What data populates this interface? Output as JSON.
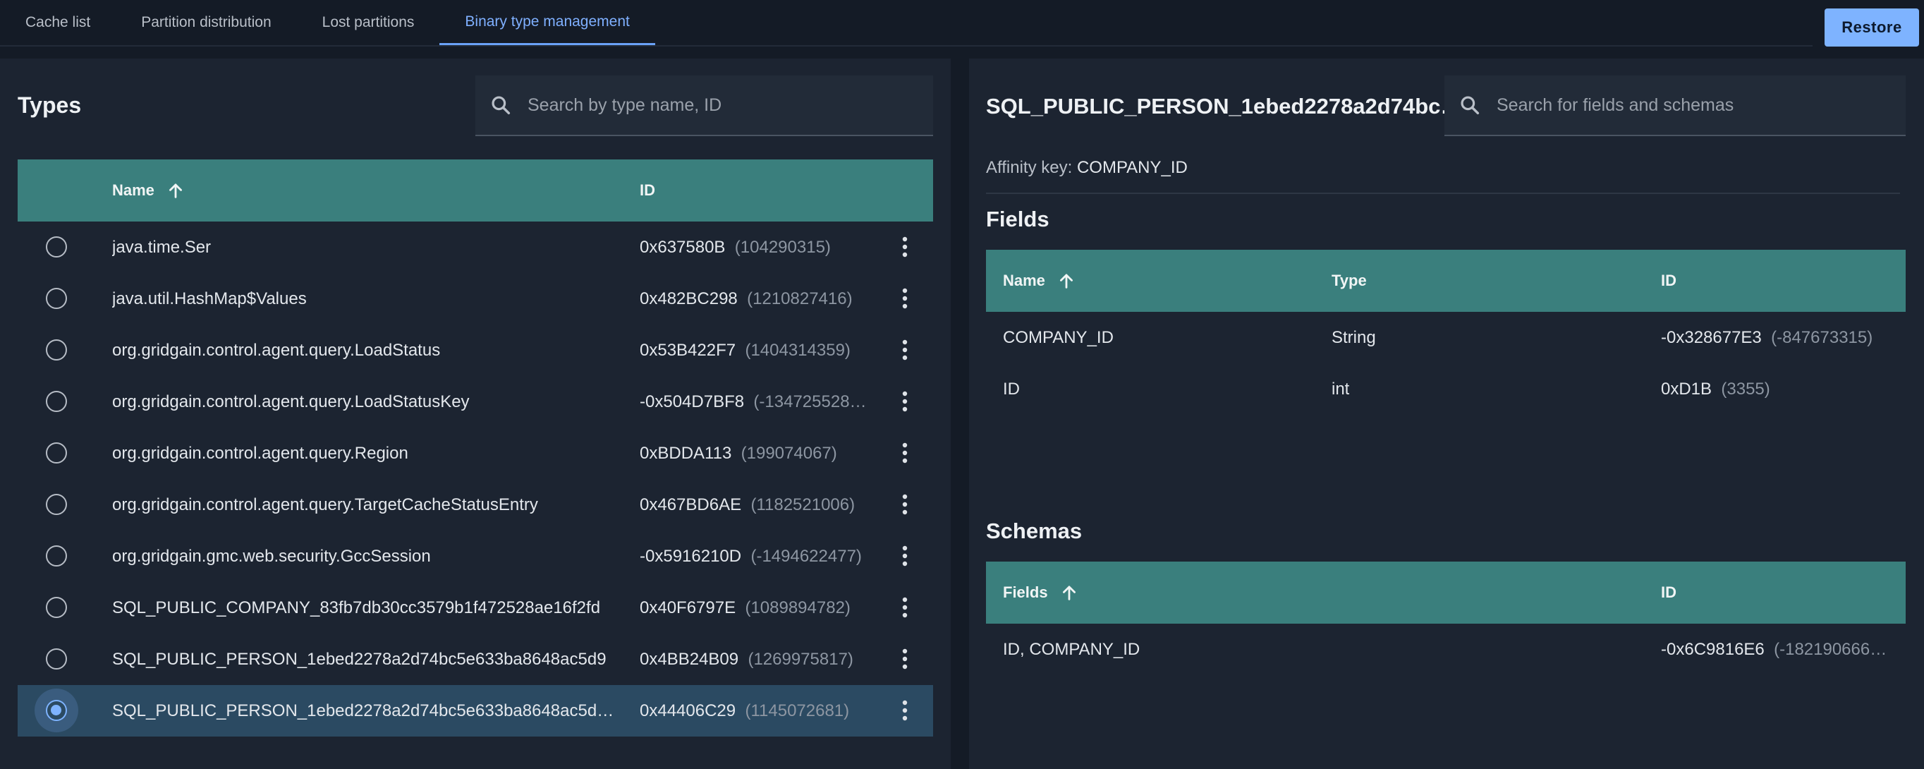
{
  "tabs": [
    {
      "label": "Cache list",
      "active": false
    },
    {
      "label": "Partition distribution",
      "active": false
    },
    {
      "label": "Lost partitions",
      "active": false
    },
    {
      "label": "Binary type management",
      "active": true
    }
  ],
  "restore_label": "Restore",
  "types_panel": {
    "title": "Types",
    "search_placeholder": "Search by type name, ID",
    "columns": {
      "name": "Name",
      "id": "ID"
    },
    "rows": [
      {
        "name": "java.time.Ser",
        "id": "0x637580B",
        "id_dec": "(104290315)",
        "selected": false
      },
      {
        "name": "java.util.HashMap$Values",
        "id": "0x482BC298",
        "id_dec": "(1210827416)",
        "selected": false
      },
      {
        "name": "org.gridgain.control.agent.query.LoadStatus",
        "id": "0x53B422F7",
        "id_dec": "(1404314359)",
        "selected": false
      },
      {
        "name": "org.gridgain.control.agent.query.LoadStatusKey",
        "id": "-0x504D7BF8",
        "id_dec": "(-134725528…",
        "selected": false
      },
      {
        "name": "org.gridgain.control.agent.query.Region",
        "id": "0xBDDA113",
        "id_dec": "(199074067)",
        "selected": false
      },
      {
        "name": "org.gridgain.control.agent.query.TargetCacheStatusEntry",
        "id": "0x467BD6AE",
        "id_dec": "(1182521006)",
        "selected": false
      },
      {
        "name": "org.gridgain.gmc.web.security.GccSession",
        "id": "-0x5916210D",
        "id_dec": "(-1494622477)",
        "selected": false
      },
      {
        "name": "SQL_PUBLIC_COMPANY_83fb7db30cc3579b1f472528ae16f2fd",
        "id": "0x40F6797E",
        "id_dec": "(1089894782)",
        "selected": false
      },
      {
        "name": "SQL_PUBLIC_PERSON_1ebed2278a2d74bc5e633ba8648ac5d9",
        "id": "0x4BB24B09",
        "id_dec": "(1269975817)",
        "selected": false
      },
      {
        "name": "SQL_PUBLIC_PERSON_1ebed2278a2d74bc5e633ba8648ac5d…",
        "id": "0x44406C29",
        "id_dec": "(1145072681)",
        "selected": true
      }
    ]
  },
  "detail_panel": {
    "title": "SQL_PUBLIC_PERSON_1ebed2278a2d74bc…",
    "search_placeholder": "Search for fields and schemas",
    "affinity_label": "Affinity key:",
    "affinity_value": "COMPANY_ID",
    "fields_title": "Fields",
    "fields_columns": {
      "name": "Name",
      "type": "Type",
      "id": "ID"
    },
    "fields": [
      {
        "name": "COMPANY_ID",
        "type": "String",
        "id": "-0x328677E3",
        "id_dec": "(-847673315)"
      },
      {
        "name": "ID",
        "type": "int",
        "id": "0xD1B",
        "id_dec": "(3355)"
      }
    ],
    "schemas_title": "Schemas",
    "schemas_columns": {
      "fields": "Fields",
      "id": "ID"
    },
    "schemas": [
      {
        "fields": "ID, COMPANY_ID",
        "id": "-0x6C9816E6",
        "id_dec": "(-182190666…"
      }
    ]
  },
  "colors": {
    "background": "#141b26",
    "panel": "#1c2431",
    "table_header": "#3a7f7d",
    "accent": "#7eb3ff",
    "selected_row": "#2b4a62"
  }
}
